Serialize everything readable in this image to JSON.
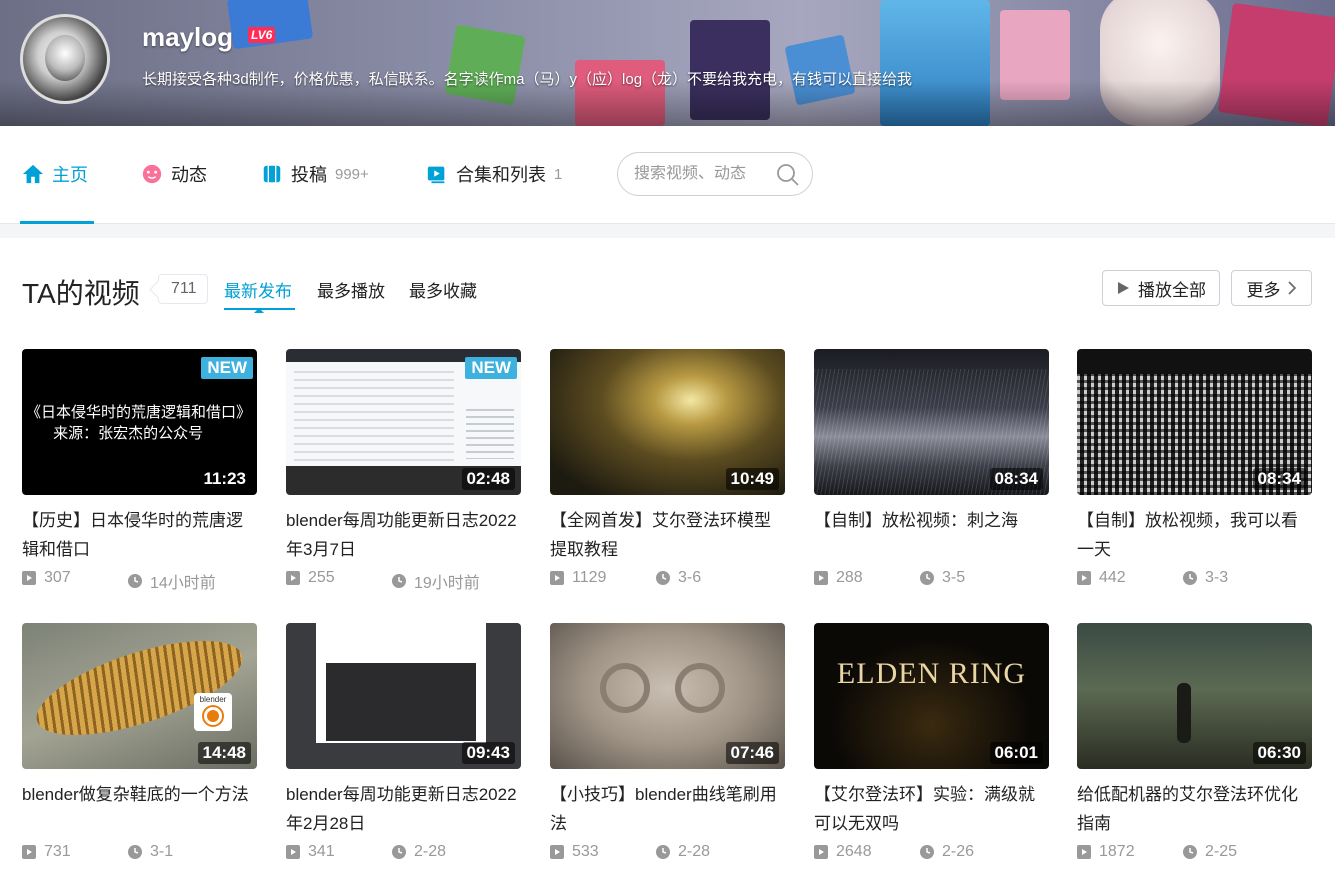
{
  "profile": {
    "username": "maylog",
    "level": "LV6",
    "signature": "长期接受各种3d制作，价格优惠，私信联系。名字读作ma（马）y（应）log（龙）不要给我充电，有钱可以直接给我"
  },
  "nav": {
    "items": [
      {
        "label": "主页",
        "count": "",
        "icon": "home-icon"
      },
      {
        "label": "动态",
        "count": "",
        "icon": "activity-icon"
      },
      {
        "label": "投稿",
        "count": "999+",
        "icon": "upload-icon"
      },
      {
        "label": "合集和列表",
        "count": "1",
        "icon": "collection-icon"
      }
    ],
    "search_placeholder": "搜索视频、动态"
  },
  "videos_section": {
    "title": "TA的视频",
    "count": "711",
    "sort_tabs": [
      "最新发布",
      "最多播放",
      "最多收藏"
    ],
    "play_all_label": "播放全部",
    "more_label": "更多"
  },
  "videos": [
    {
      "title": "【历史】日本侵华时的荒唐逻辑和借口",
      "duration": "11:23",
      "plays": "307",
      "time": "14小时前",
      "new": "NEW",
      "thumb_text": "《日本侵华时的荒唐逻辑和借口》\n   来源：张宏杰的公众号"
    },
    {
      "title": "blender每周功能更新日志2022年3月7日",
      "duration": "02:48",
      "plays": "255",
      "time": "19小时前",
      "new": "NEW"
    },
    {
      "title": "【全网首发】艾尔登法环模型提取教程",
      "duration": "10:49",
      "plays": "1129",
      "time": "3-6"
    },
    {
      "title": "【自制】放松视频：刺之海",
      "duration": "08:34",
      "plays": "288",
      "time": "3-5"
    },
    {
      "title": "【自制】放松视频，我可以看一天",
      "duration": "08:34",
      "plays": "442",
      "time": "3-3"
    },
    {
      "title": "blender做复杂鞋底的一个方法",
      "duration": "14:48",
      "plays": "731",
      "time": "3-1",
      "thumb_text": "blender"
    },
    {
      "title": "blender每周功能更新日志2022年2月28日",
      "duration": "09:43",
      "plays": "341",
      "time": "2-28"
    },
    {
      "title": "【小技巧】blender曲线笔刷用法",
      "duration": "07:46",
      "plays": "533",
      "time": "2-28"
    },
    {
      "title": "【艾尔登法环】实验：满级就可以无双吗",
      "duration": "06:01",
      "plays": "2648",
      "time": "2-26",
      "thumb_text": "ELDEN RING"
    },
    {
      "title": "给低配机器的艾尔登法环优化指南",
      "duration": "06:30",
      "plays": "1872",
      "time": "2-25"
    }
  ],
  "colors": {
    "accent": "#00a1d6",
    "new_badge": "#3fb1de",
    "level_badge": "#ff2d55",
    "muted_text": "#999999"
  }
}
